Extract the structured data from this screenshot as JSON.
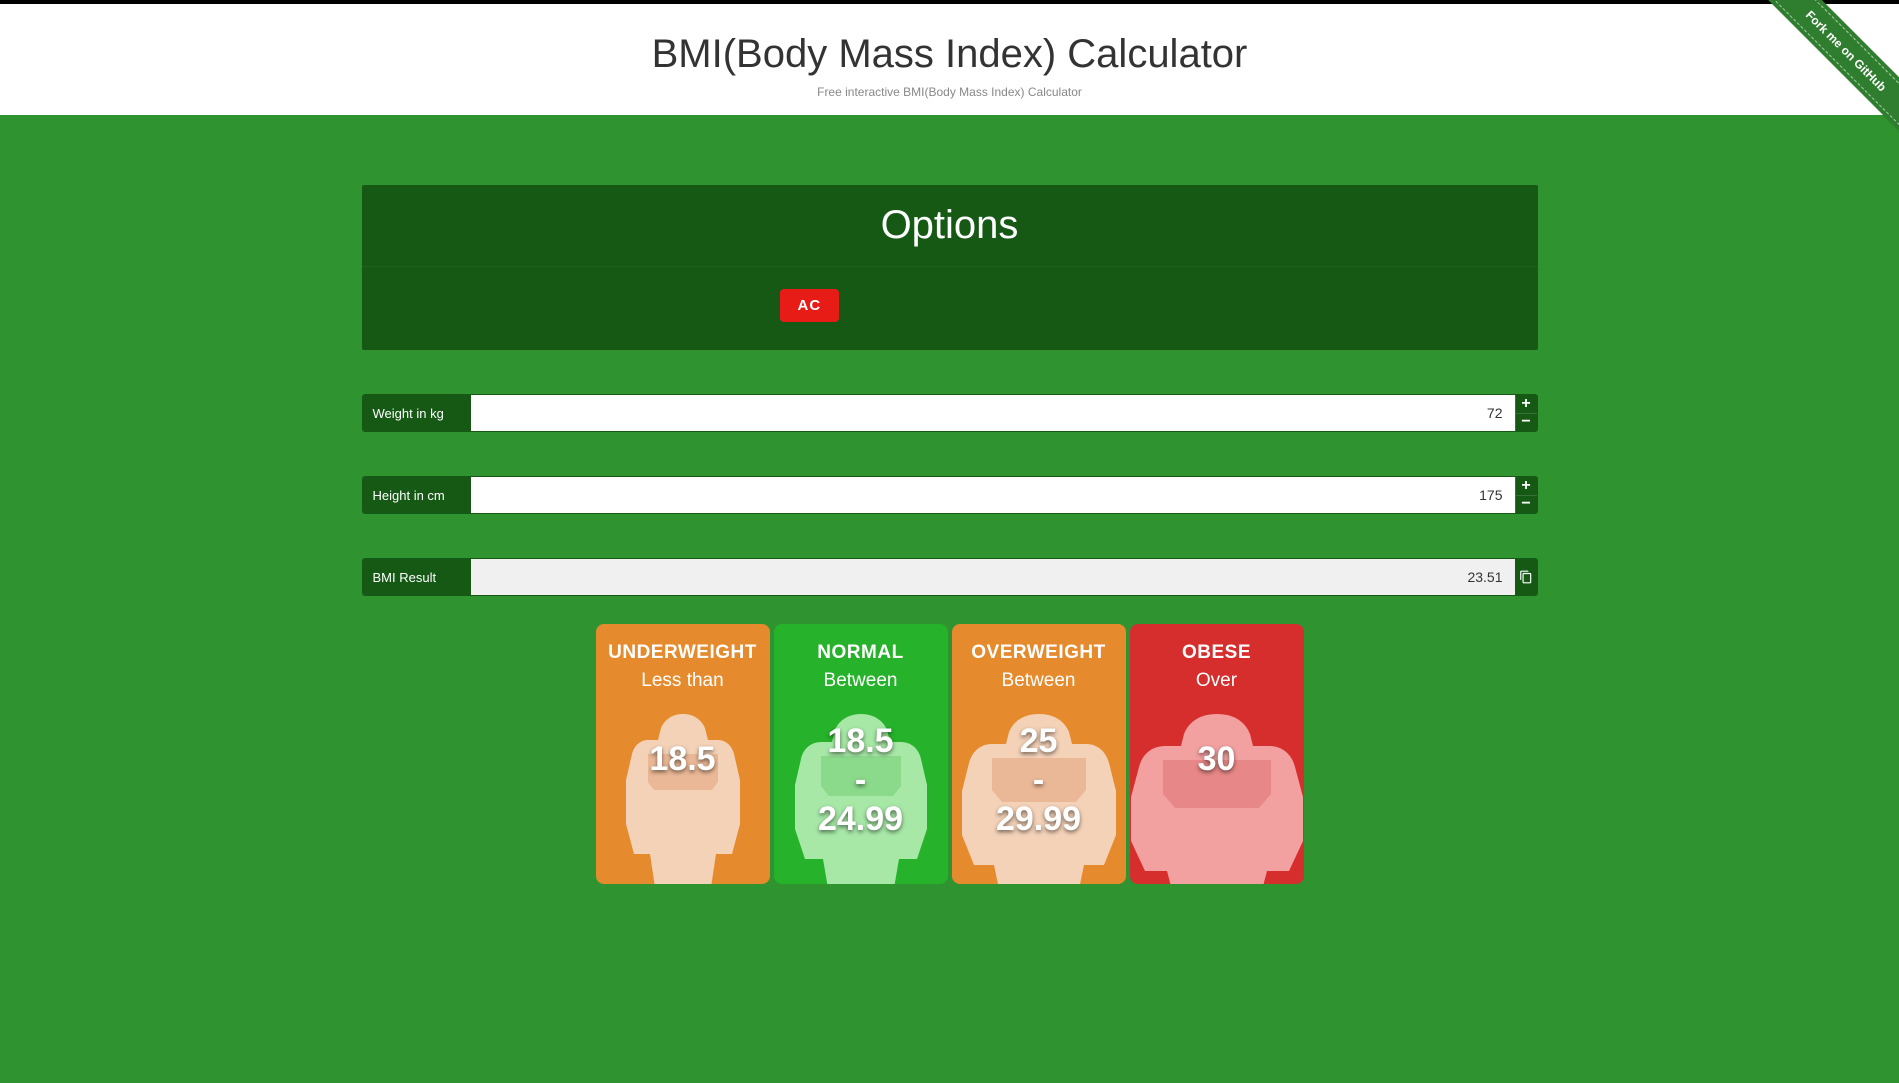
{
  "header": {
    "title": "BMI(Body Mass Index) Calculator",
    "subtitle": "Free interactive BMI(Body Mass Index) Calculator"
  },
  "ribbon": {
    "label": "Fork me on GitHub"
  },
  "options": {
    "title": "Options",
    "ac_label": "AC"
  },
  "inputs": {
    "weight": {
      "label": "Weight in kg",
      "value": "72"
    },
    "height": {
      "label": "Height in cm",
      "value": "175"
    },
    "result": {
      "label": "BMI Result",
      "value": "23.51"
    }
  },
  "categories": {
    "underweight": {
      "title": "UNDERWEIGHT",
      "sub": "Less than",
      "range": "18.5"
    },
    "normal": {
      "title": "NORMAL",
      "sub": "Between",
      "range": "18.5\n-\n24.99"
    },
    "overweight": {
      "title": "OVERWEIGHT",
      "sub": "Between",
      "range": "25\n-\n29.99"
    },
    "obese": {
      "title": "OBESE",
      "sub": "Over",
      "range": "30"
    }
  }
}
